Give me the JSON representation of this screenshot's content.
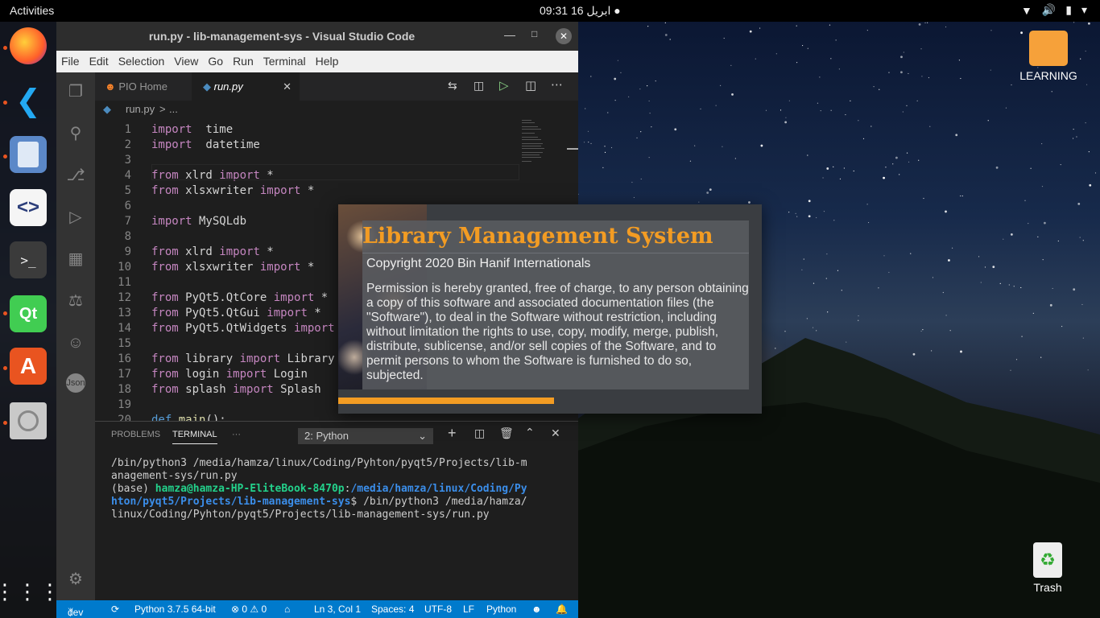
{
  "topbar": {
    "activities": "Activities",
    "clock": "09:31  ابریل 16 ●"
  },
  "desktop": {
    "folder_label": "LEARNING",
    "trash_label": "Trash"
  },
  "vscode": {
    "title": "run.py - lib-management-sys - Visual Studio Code",
    "menu": [
      "File",
      "Edit",
      "Selection",
      "View",
      "Go",
      "Run",
      "Terminal",
      "Help"
    ],
    "tabs": [
      {
        "label": "PIO Home"
      },
      {
        "label": "run.py"
      }
    ],
    "breadcrumb": {
      "file": "run.py",
      "sep": ">",
      "more": "..."
    },
    "code_lines": [
      {
        "n": "1",
        "tokens": [
          [
            "kw",
            "import"
          ],
          [
            "",
            "  time"
          ]
        ]
      },
      {
        "n": "2",
        "tokens": [
          [
            "kw",
            "import"
          ],
          [
            "",
            "  datetime"
          ]
        ]
      },
      {
        "n": "3",
        "tokens": []
      },
      {
        "n": "4",
        "tokens": [
          [
            "kw",
            "from"
          ],
          [
            "",
            " xlrd "
          ],
          [
            "kw",
            "import"
          ],
          [
            "",
            " *"
          ]
        ]
      },
      {
        "n": "5",
        "tokens": [
          [
            "kw",
            "from"
          ],
          [
            "",
            " xlsxwriter "
          ],
          [
            "kw",
            "import"
          ],
          [
            "",
            " *"
          ]
        ]
      },
      {
        "n": "6",
        "tokens": []
      },
      {
        "n": "7",
        "tokens": [
          [
            "kw",
            "import"
          ],
          [
            "",
            " MySQLdb"
          ]
        ]
      },
      {
        "n": "8",
        "tokens": []
      },
      {
        "n": "9",
        "tokens": [
          [
            "kw",
            "from"
          ],
          [
            "",
            " xlrd "
          ],
          [
            "kw",
            "import"
          ],
          [
            "",
            " *"
          ]
        ]
      },
      {
        "n": "10",
        "tokens": [
          [
            "kw",
            "from"
          ],
          [
            "",
            " xlsxwriter "
          ],
          [
            "kw",
            "import"
          ],
          [
            "",
            " *"
          ]
        ]
      },
      {
        "n": "11",
        "tokens": []
      },
      {
        "n": "12",
        "tokens": [
          [
            "kw",
            "from"
          ],
          [
            "",
            " PyQt5.QtCore "
          ],
          [
            "kw",
            "import"
          ],
          [
            "",
            " *"
          ]
        ]
      },
      {
        "n": "13",
        "tokens": [
          [
            "kw",
            "from"
          ],
          [
            "",
            " PyQt5.QtGui "
          ],
          [
            "kw",
            "import"
          ],
          [
            "",
            " *"
          ]
        ]
      },
      {
        "n": "14",
        "tokens": [
          [
            "kw",
            "from"
          ],
          [
            "",
            " PyQt5.QtWidgets "
          ],
          [
            "kw",
            "import"
          ]
        ]
      },
      {
        "n": "15",
        "tokens": []
      },
      {
        "n": "16",
        "tokens": [
          [
            "kw",
            "from"
          ],
          [
            "",
            " library "
          ],
          [
            "kw",
            "import"
          ],
          [
            "",
            " Library"
          ]
        ]
      },
      {
        "n": "17",
        "tokens": [
          [
            "kw",
            "from"
          ],
          [
            "",
            " login "
          ],
          [
            "kw",
            "import"
          ],
          [
            "",
            " Login"
          ]
        ]
      },
      {
        "n": "18",
        "tokens": [
          [
            "kw",
            "from"
          ],
          [
            "",
            " splash "
          ],
          [
            "kw",
            "import"
          ],
          [
            "",
            " Splash"
          ]
        ]
      },
      {
        "n": "19",
        "tokens": []
      },
      {
        "n": "20",
        "tokens": [
          [
            "kw2",
            "def"
          ],
          [
            "",
            " "
          ],
          [
            "fn",
            "main"
          ],
          [
            "",
            "():"
          ]
        ]
      }
    ],
    "panel": {
      "tabs": [
        "PROBLEMS",
        "TERMINAL",
        "···"
      ],
      "terminal_select": "2: Python",
      "lines": [
        [
          [
            "",
            "/bin/python3 /media/hamza/linux/Coding/Pyhton/pyqt5/Projects/lib-m"
          ]
        ],
        [
          [
            "",
            "anagement-sys/run.py"
          ]
        ],
        [
          [
            "",
            "(base) "
          ],
          [
            "green",
            "hamza@hamza-HP-EliteBook-8470p"
          ],
          [
            "",
            ":"
          ],
          [
            "blue",
            "/media/hamza/linux/Coding/Py"
          ]
        ],
        [
          [
            "blue",
            "hton/pyqt5/Projects/lib-management-sys"
          ],
          [
            "",
            "$ /bin/python3 /media/hamza/"
          ]
        ],
        [
          [
            "",
            "linux/Coding/Pyhton/pyqt5/Projects/lib-management-sys/run.py"
          ]
        ]
      ]
    },
    "status": {
      "branch": "dev",
      "python": "Python 3.7.5 64-bit",
      "errors": "⊗ 0 ⚠ 0",
      "position": "Ln 3, Col 1",
      "spaces": "Spaces: 4",
      "encoding": "UTF-8",
      "eol": "LF",
      "language": "Python"
    },
    "accent": "#007acc"
  },
  "splash": {
    "title": "Library Management System",
    "copyright": "Copyright 2020 Bin Hanif Internationals",
    "text": "Permission is hereby granted, free of charge, to any person obtaining a copy of this software and associated documentation files (the \"Software\"), to deal in the Software without restriction, including without limitation the rights to use, copy, modify, merge, publish, distribute, sublicense, and/or sell copies of the Software, and to permit persons to whom the Software is furnished to do so, subjected.",
    "progress": 0.51,
    "accent": "#f39c23"
  }
}
